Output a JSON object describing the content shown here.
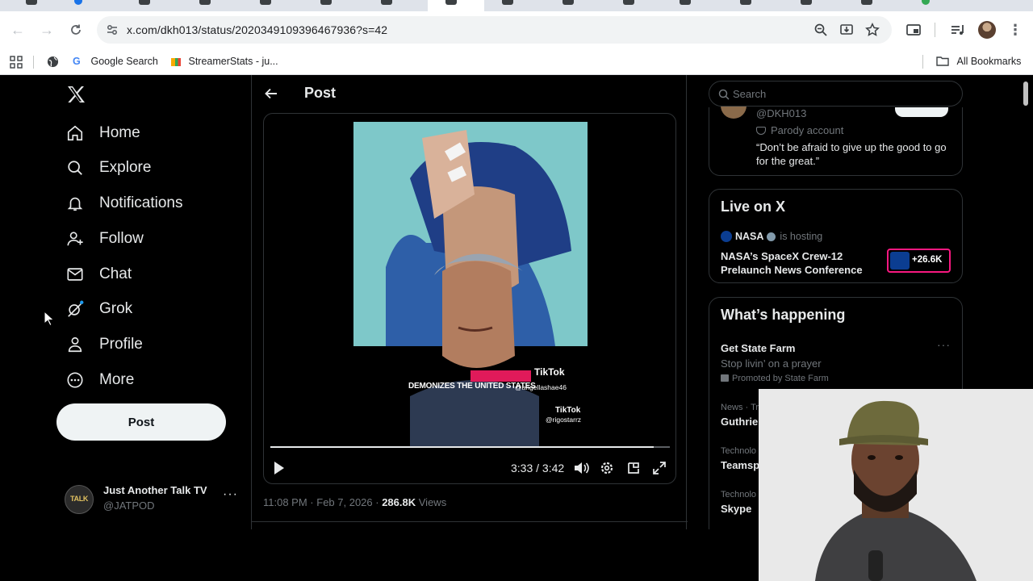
{
  "browser": {
    "url": "x.com/dkh013/status/2020349109396467936?s=42",
    "bookmarks": [
      "Google Search",
      "StreamerStats - ju..."
    ],
    "all_bookmarks": "All Bookmarks"
  },
  "sidebar": {
    "items": [
      {
        "label": "Home",
        "icon": "home-icon"
      },
      {
        "label": "Explore",
        "icon": "search-icon"
      },
      {
        "label": "Notifications",
        "icon": "bell-icon"
      },
      {
        "label": "Follow",
        "icon": "person-add-icon"
      },
      {
        "label": "Chat",
        "icon": "mail-icon"
      },
      {
        "label": "Grok",
        "icon": "grok-icon"
      },
      {
        "label": "Profile",
        "icon": "person-icon"
      },
      {
        "label": "More",
        "icon": "more-circle-icon"
      }
    ],
    "post_button": "Post",
    "account": {
      "name": "Just Another Talk TV",
      "handle": "@JATPOD",
      "avatar_text": "TALK"
    }
  },
  "main": {
    "header_title": "Post",
    "video": {
      "overlay_text": "DEMONIZES THE UNITED STATES",
      "tiktok_label": "TikTok",
      "tiktok_handle_1": "@angellashae46",
      "tiktok_handle_2": "@rigostarrz",
      "time": "3:33 / 3:42",
      "progress": 0.96
    },
    "meta": {
      "time": "11:08 PM",
      "date": "Feb 7, 2026",
      "views": "286.8K",
      "views_label": "Views"
    }
  },
  "right": {
    "search_placeholder": "Search",
    "profile_card": {
      "handle": "@DKH013",
      "parody": "Parody account",
      "bio": "“Don’t be afraid to give up the good to go for the great.”"
    },
    "live": {
      "title": "Live on X",
      "host": "NASA",
      "host_suffix": "is hosting",
      "event": "NASA’s SpaceX Crew-12 Prelaunch News Conference",
      "count": "+26.6K"
    },
    "happening": {
      "title": "What’s happening",
      "ad_title": "Get State Farm",
      "ad_sub": "Stop livin’ on a prayer",
      "ad_promo": "Promoted by State Farm",
      "trends": [
        {
          "category": "News · Tr",
          "title": "Guthrie"
        },
        {
          "category": "Technolo",
          "title": "Teamsp"
        },
        {
          "category": "Technolo",
          "title": "Skype"
        }
      ]
    }
  }
}
